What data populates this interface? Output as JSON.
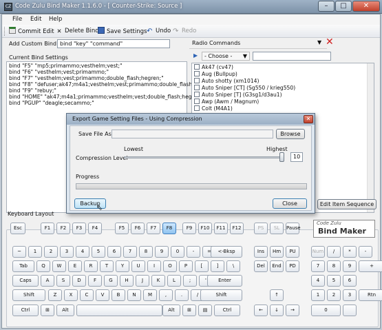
{
  "window": {
    "title": "Code Zulu Bind Maker 1.1.6.0  -  [ Counter-Strike: Source ]",
    "icon_text": "CZ"
  },
  "menu": [
    "File",
    "Edit",
    "Help"
  ],
  "toolbar": {
    "commit": "Commit Edit",
    "delete": "Delete Bind",
    "save": "Save Settings",
    "undo": "Undo",
    "redo": "Redo"
  },
  "custom_bind": {
    "label": "Add Custom Bind:",
    "value": "bind \"key\" \"command\""
  },
  "current_binds": {
    "label": "Current Bind Settings",
    "lines": [
      "bind \"F5\" \"mp5;primammo;vesthelm;vest;\"",
      "bind \"F6\" \"vesthelm;vest;primammo;\"",
      "bind \"F7\" \"vesthelm;vest;primammo;double_flash;hegren;\"",
      "bind \"F8\" \"defuser;ak47;m4a1;vesthelm;vest;primammo;double_flash;hegren;\"",
      "bind \"F9\" \"rebuy;\"",
      "bind \"HOME\" \"ak47;m4a1;primammo;vesthelm;vest;double_flash;hegren;defu",
      "bind \"PGUP\" \"deagle;secammo;\""
    ]
  },
  "radio": {
    "label": "Radio Commands",
    "choose": "- Choose -",
    "items": [
      "Ak47 (cv47)",
      "Aug (Bullpup)",
      "Auto shotty (xm1014)",
      "Auto Sniper [CT] (Sg550 / krieg550)",
      "Auto Sniper [T] (G3sg1/d3au1)",
      "Awp (Awm / Magnum)",
      "Colt (M4A1)"
    ]
  },
  "edit_item_sequence": "Edit Item Sequence",
  "keyboard": {
    "label": "Keyboard Layout",
    "row_f": [
      "Esc",
      "F1",
      "F2",
      "F3",
      "F4",
      "F5",
      "F6",
      "F7",
      "F8",
      "F9",
      "F10",
      "F11",
      "F12"
    ],
    "row_num": [
      "~",
      "1",
      "2",
      "3",
      "4",
      "5",
      "6",
      "7",
      "8",
      "9",
      "0",
      "-",
      "=",
      "<-Bksp"
    ],
    "row_q": [
      "Tab",
      "Q",
      "W",
      "E",
      "R",
      "T",
      "Y",
      "U",
      "I",
      "O",
      "P",
      "[",
      "]",
      "\\"
    ],
    "row_a": [
      "Caps",
      "A",
      "S",
      "D",
      "F",
      "G",
      "H",
      "J",
      "K",
      "L",
      ";",
      "'",
      "Enter"
    ],
    "row_z": [
      "Shift",
      "Z",
      "X",
      "C",
      "V",
      "B",
      "N",
      "M",
      ",",
      ".",
      "/",
      "Shift"
    ],
    "row_ctrl": [
      "Ctrl",
      "Alt",
      "Alt",
      "Ctrl"
    ],
    "nav": [
      "PS",
      "SL",
      "Pause",
      "Ins",
      "Hm",
      "PU",
      "Del",
      "End",
      "PD"
    ],
    "numpad": [
      "Num",
      "/",
      "*",
      "-",
      "7",
      "8",
      "9",
      "+",
      "4",
      "5",
      "6",
      "1",
      "2",
      "3",
      "0",
      "Rtn"
    ],
    "arrows": [
      "↑",
      "←",
      "↓",
      "→"
    ],
    "logo_small": "Code Zulu",
    "logo_big": "Bind Maker"
  },
  "dialog": {
    "title": "Export Game Setting Files - Using Compression",
    "save_as": "Save File As",
    "browse": "Browse",
    "compression": "Compression Level",
    "lowest": "Lowest",
    "highest": "Highest",
    "level": "10",
    "progress": "Progress",
    "backup": "Backup",
    "close": "Close",
    "level_fraction": 1.0,
    "progress_fraction": 0
  }
}
